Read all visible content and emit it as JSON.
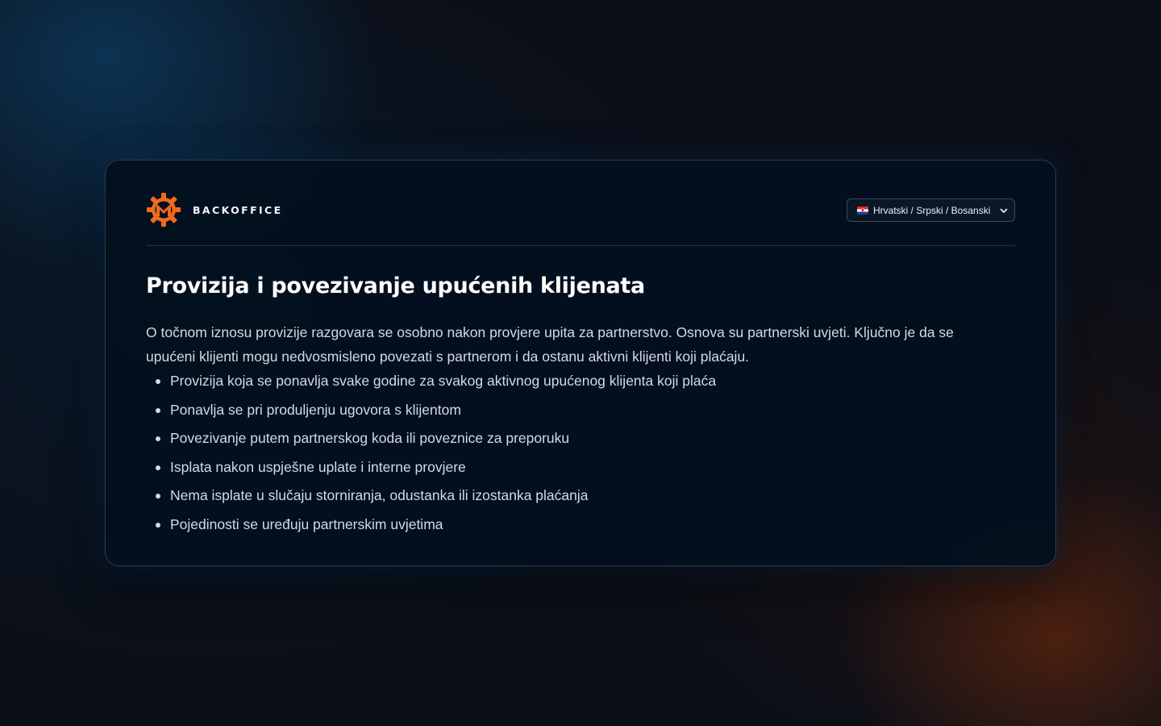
{
  "brand": {
    "name": "BACKOFFICE",
    "logo_icon": "gear-m-logo-icon",
    "logo_color": "#f26a1b"
  },
  "language_selector": {
    "selected": "Hrvatski / Srpski / Bosanski",
    "flag_icon": "croatia-flag-icon",
    "chevron_icon": "chevron-down-icon"
  },
  "content": {
    "title": "Provizija i povezivanje upućenih klijenata",
    "intro": "O točnom iznosu provizije razgovara se osobno nakon provjere upita za partnerstvo. Osnova su partnerski uvjeti. Ključno je da se upućeni klijenti mogu nedvosmisleno povezati s partnerom i da ostanu aktivni klijenti koji plaćaju.",
    "bullets": [
      "Provizija koja se ponavlja svake godine za svakog aktivnog upućenog klijenta koji plaća",
      "Ponavlja se pri produljenju ugovora s klijentom",
      "Povezivanje putem partnerskog koda ili poveznice za preporuku",
      "Isplata nakon uspješne uplate i interne provjere",
      "Nema isplate u slučaju storniranja, odustanka ili izostanka plaćanja",
      "Pojedinosti se uređuju partnerskim uvjetima"
    ]
  },
  "colors": {
    "background": "#0b0f18",
    "card_background": "#03101e",
    "card_border": "#2a3a4e",
    "accent": "#f26a1b",
    "text": "#d3dae4",
    "title": "#ffffff"
  }
}
